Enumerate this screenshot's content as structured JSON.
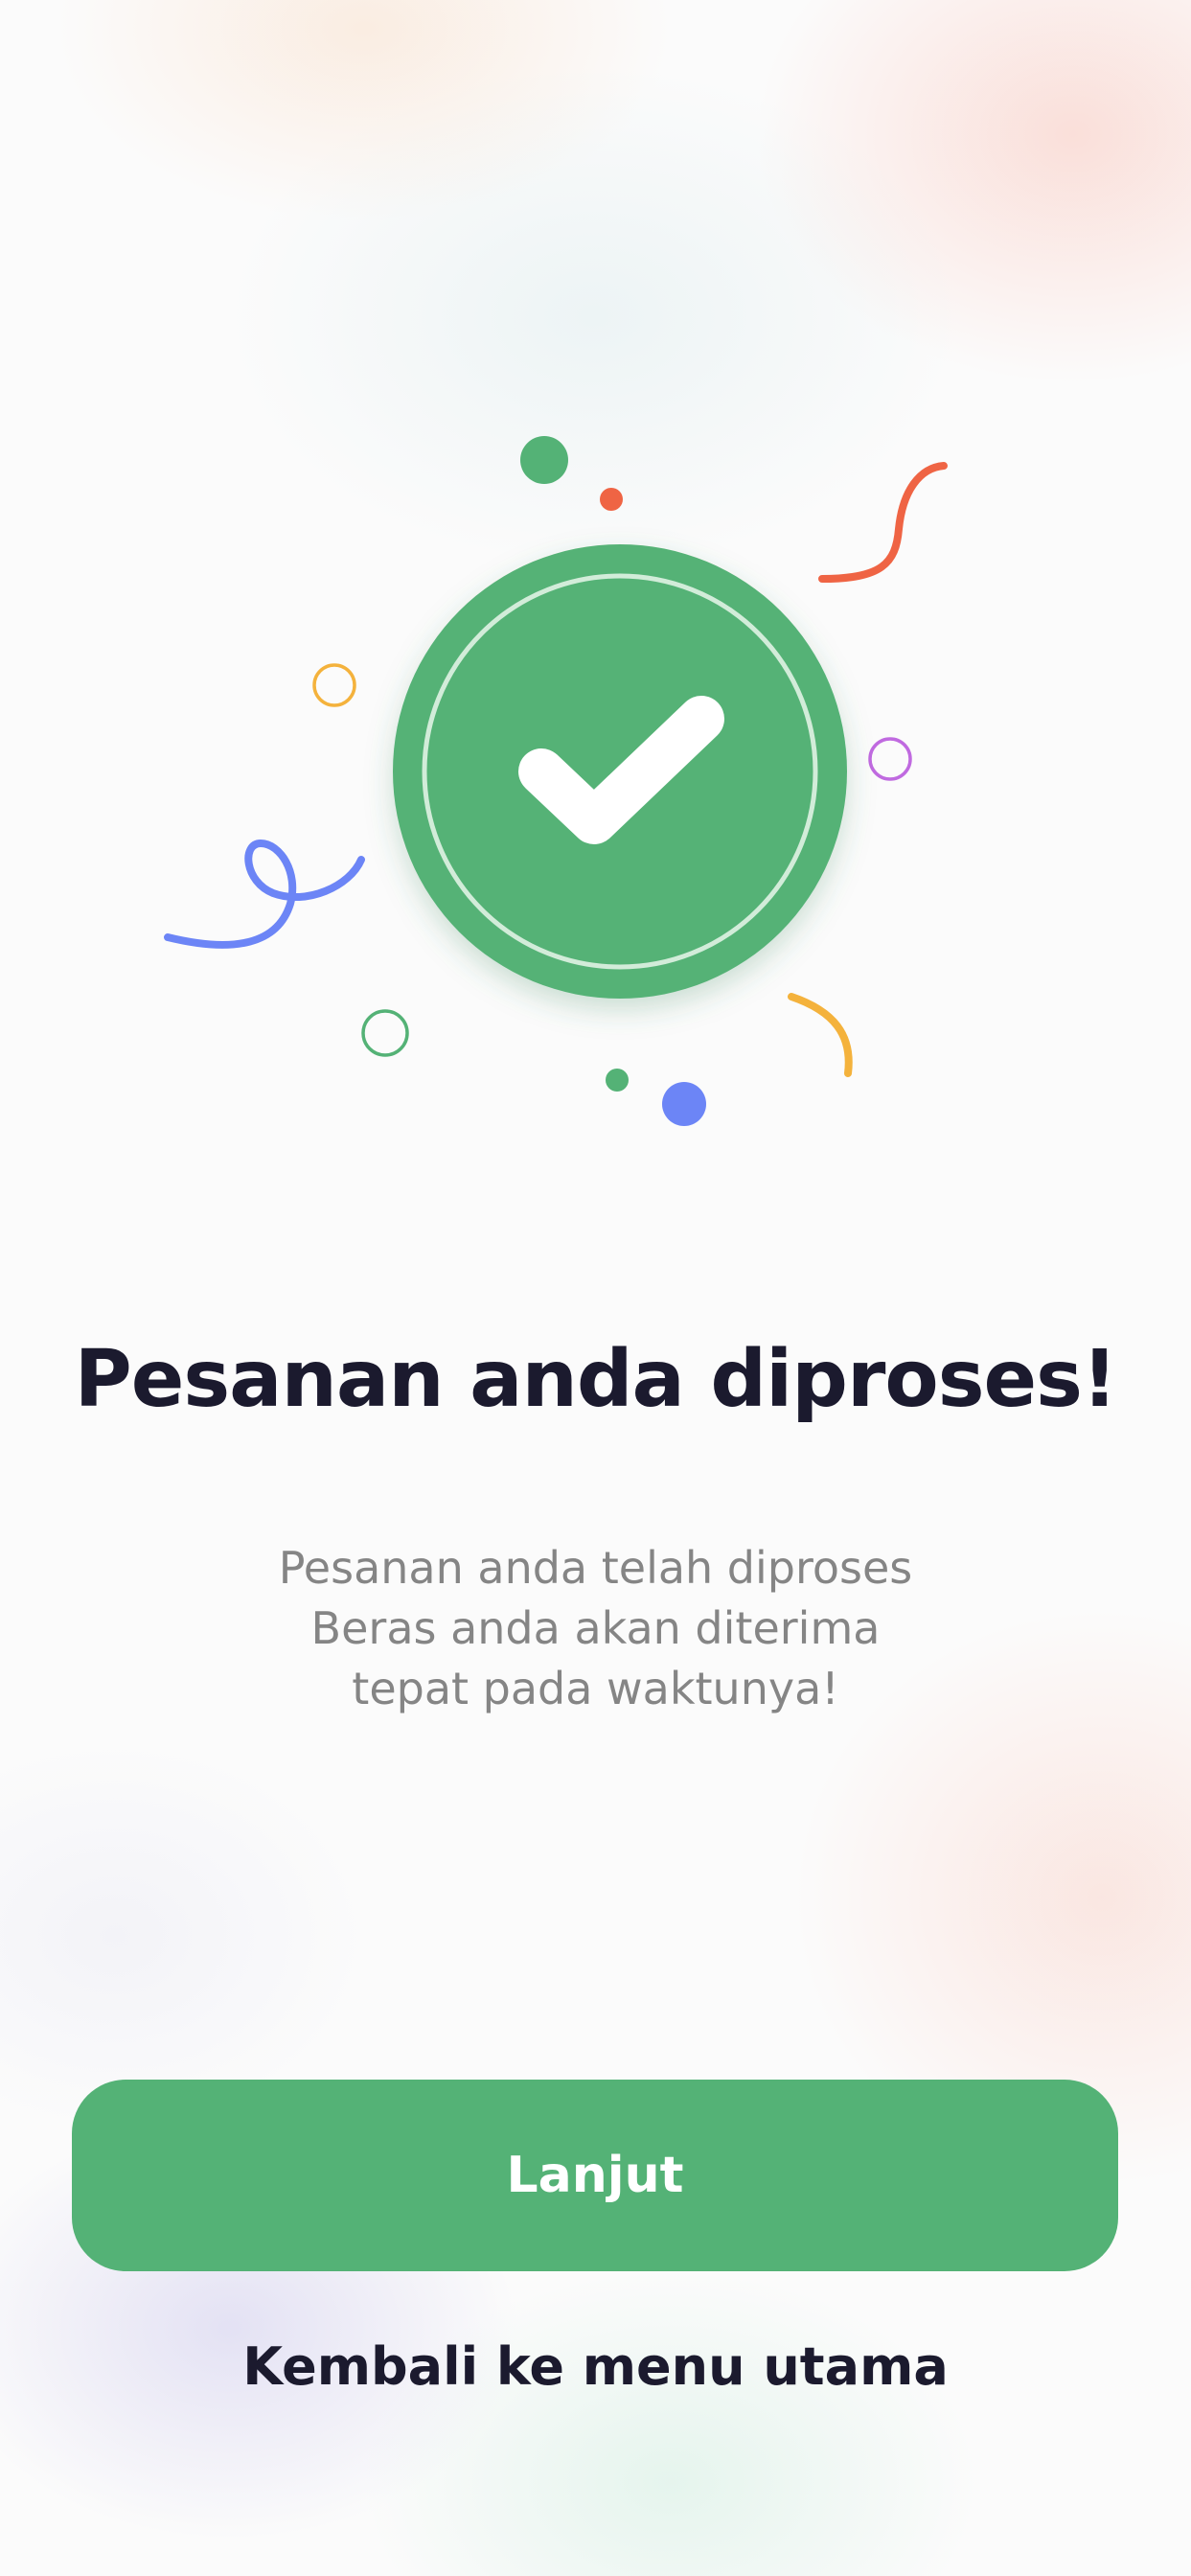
{
  "success": {
    "title": "Pesanan anda diproses!",
    "message_lines": [
      "Pesanan anda telah diproses",
      "Beras anda akan diterima",
      "tepat pada waktunya!"
    ]
  },
  "actions": {
    "primary_label": "Lanjut",
    "secondary_label": "Kembali ke menu utama"
  },
  "icons": {
    "badge": "check-circle-icon",
    "decoration": "confetti"
  },
  "colors": {
    "brand_green": "#54b276",
    "title_text": "#1b1a2e",
    "body_text": "#858585",
    "confetti_orange": "#ef6444",
    "confetti_blue": "#6c85f6",
    "confetti_yellow": "#f4b23c",
    "confetti_purple": "#c06ae0"
  }
}
